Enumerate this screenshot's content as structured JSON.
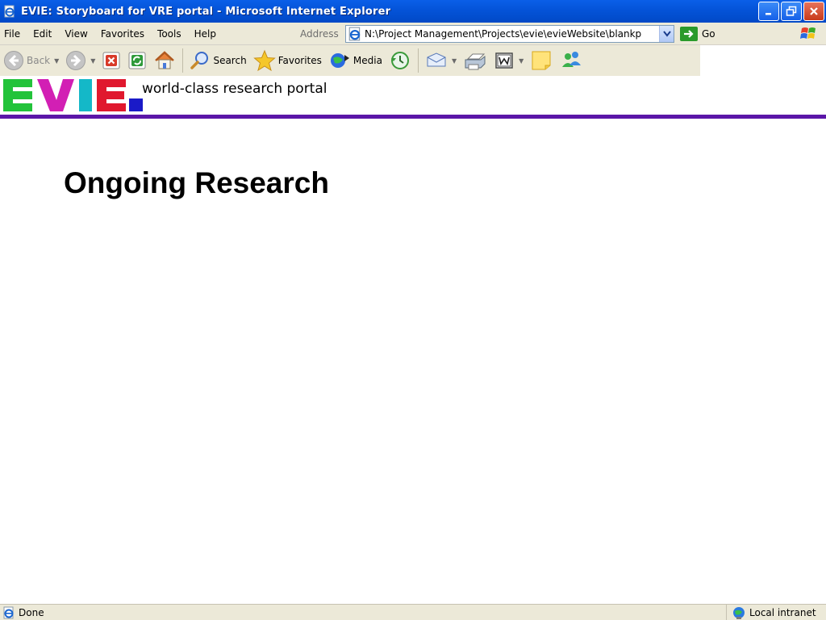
{
  "window": {
    "title": "EVIE: Storyboard for VRE portal - Microsoft Internet Explorer"
  },
  "menu": {
    "items": [
      "File",
      "Edit",
      "View",
      "Favorites",
      "Tools",
      "Help"
    ],
    "address_label": "Address",
    "address_value": "N:\\Project Management\\Projects\\evie\\evieWebsite\\blankp",
    "go_label": "Go"
  },
  "toolbar": {
    "back_label": "Back",
    "search_label": "Search",
    "favorites_label": "Favorites",
    "media_label": "Media"
  },
  "page": {
    "tagline": "world-class research portal",
    "heading": "Ongoing Research",
    "logo_text": "EVIE",
    "colors": {
      "rule": "#5b16a8",
      "logo_e1": "#22c33a",
      "logo_v": "#d21fb4",
      "logo_i": "#14b8c8",
      "logo_e2": "#e0182e",
      "logo_dot": "#1a1ac8"
    }
  },
  "status": {
    "left_text": "Done",
    "zone_text": "Local intranet"
  },
  "icons": {
    "title": "ie-page-icon",
    "back": "back-arrow-icon",
    "forward": "forward-arrow-icon",
    "stop": "stop-icon",
    "refresh": "refresh-icon",
    "home": "home-icon",
    "search": "search-magnifier-icon",
    "favorites": "favorites-star-icon",
    "media": "media-icon",
    "history": "history-icon",
    "mail": "mail-icon",
    "print": "print-icon",
    "edit": "word-edit-icon",
    "discuss": "discuss-note-icon",
    "messenger": "messenger-icon"
  }
}
